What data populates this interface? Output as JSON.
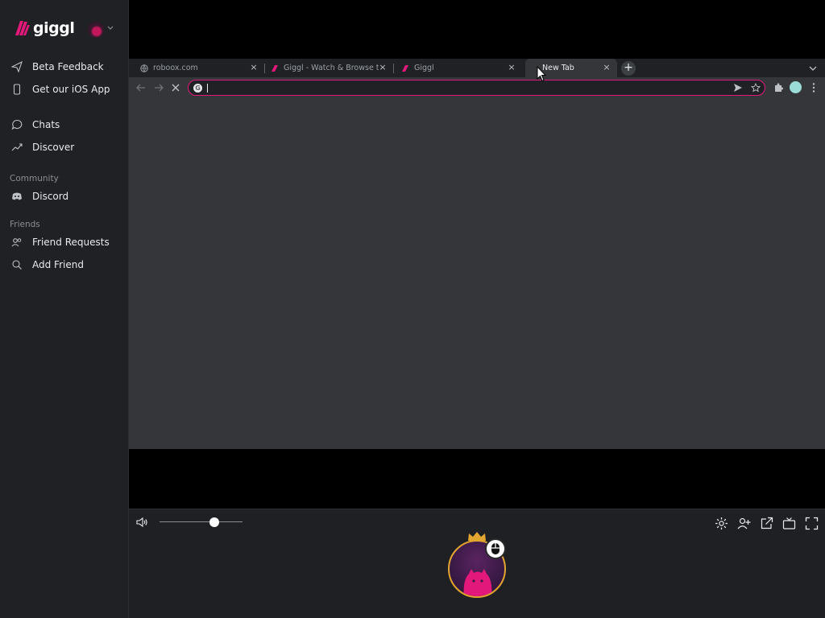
{
  "app": {
    "name": "giggl"
  },
  "sidebar": {
    "items_top": [
      {
        "label": "Beta Feedback",
        "icon": "send-icon"
      },
      {
        "label": "Get our iOS App",
        "icon": "phone-icon"
      }
    ],
    "items_main": [
      {
        "label": "Chats",
        "icon": "chat-bubble-icon"
      },
      {
        "label": "Discover",
        "icon": "trending-icon"
      }
    ],
    "community": {
      "heading": "Community",
      "items": [
        {
          "label": "Discord",
          "icon": "discord-icon"
        }
      ]
    },
    "friends": {
      "heading": "Friends",
      "items": [
        {
          "label": "Friend Requests",
          "icon": "people-icon"
        },
        {
          "label": "Add Friend",
          "icon": "search-icon"
        }
      ]
    }
  },
  "browser": {
    "tabs": [
      {
        "label": "roboox.com",
        "icon": "globe-icon",
        "active": false
      },
      {
        "label": "Giggl - Watch & Browse the",
        "icon": "giggl-logo-icon",
        "active": false
      },
      {
        "label": "Giggl",
        "icon": "giggl-logo-icon",
        "active": false
      },
      {
        "label": "New Tab",
        "icon": "none",
        "active": true
      }
    ],
    "close_glyph": "×",
    "new_tab_glyph": "+",
    "omnibox": {
      "value": "",
      "badge": "G"
    }
  },
  "colors": {
    "accent": "#e2187b",
    "sidebar_bg": "#202124",
    "browser_bg": "#35363a",
    "host_ring": "#e2a530"
  },
  "controls": {
    "volume_level": 0.66
  }
}
